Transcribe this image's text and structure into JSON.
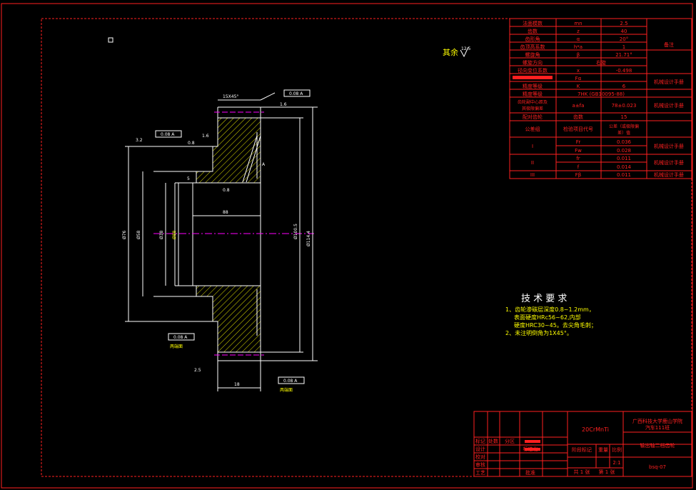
{
  "colors": {
    "background": "#000000",
    "frame": "#ff2020",
    "outline": "#ffffff",
    "dimension": "#ffff00",
    "centerline": "#ff00ff",
    "hatch": "#ffff00"
  },
  "surface_note": {
    "text": "其余",
    "roughness": "12.5"
  },
  "gear_drawing": {
    "chamfer_label": "15X45°",
    "tolerance_boxes": [
      "0.08 A",
      "0.08 A",
      "0.08 A",
      "0.08 A"
    ],
    "datum": "A",
    "dims": {
      "d_left_outer": "Ø76",
      "d_left_mid": "Ø58",
      "d_bore": "Ø38",
      "d_inner": "Ø88",
      "d_pitch": "Ø100.5",
      "d_tip": "Ø114.4",
      "width": "18",
      "bore_len": "88",
      "step_a": "1.6",
      "step_b": "0.8",
      "small_a": "2.5",
      "small_b": "5",
      "rough_a": "3.2",
      "rough_b": "1.6",
      "rough_c": "0.8"
    },
    "notes": [
      "两端面",
      "两端面"
    ]
  },
  "param_table": {
    "rows": [
      {
        "name": "法面模数",
        "symbol": "mn",
        "value": "2.5",
        "note": ""
      },
      {
        "name": "齿数",
        "symbol": "z",
        "value": "40",
        "note": ""
      },
      {
        "name": "齿形角",
        "symbol": "α",
        "value": "20°",
        "note": ""
      },
      {
        "name": "齿顶高系数",
        "symbol": "h*a",
        "value": "1",
        "note": ""
      },
      {
        "name": "螺旋角",
        "symbol": "β",
        "value": "21.71°",
        "note": ""
      },
      {
        "name": "螺旋方向",
        "symbol": "",
        "value": "右旋",
        "note": ""
      },
      {
        "name": "径向变位系数",
        "symbol": "x",
        "value": "-0.498",
        "note": ""
      },
      {
        "name": "",
        "symbol": "Fα",
        "value": "",
        "note": "机械设计手册"
      },
      {
        "name": "精度等级",
        "symbol": "K",
        "value": "6",
        "note": ""
      },
      {
        "name": "精度等级",
        "symbol": "",
        "value": "7HK (GB10095-88)",
        "note": ""
      },
      {
        "name": "齿轮副中心距及其极限偏差",
        "symbol": "a±fa",
        "value": "78±0.023",
        "note": "机械设计手册"
      },
      {
        "name": "配对齿轮",
        "symbol": "齿数",
        "value": "15",
        "note": ""
      }
    ],
    "group_header": {
      "a": "公差组",
      "b": "检验项目代号",
      "c": "公差（或极限偏差）值",
      "d": ""
    },
    "groups": [
      {
        "group": "I",
        "code1": "Fr",
        "val1": "0.036",
        "code2": "Fw",
        "val2": "0.028",
        "note": "机械设计手册"
      },
      {
        "group": "II",
        "code1": "fr",
        "val1": "0.011",
        "code2": "f",
        "val2": "0.014",
        "note": "机械设计手册"
      },
      {
        "group": "III",
        "code1": "Fβ",
        "val1": "0.011",
        "code2": "",
        "val2": "",
        "note": "机械设计手册"
      }
    ],
    "side_note": "备注"
  },
  "tech_req": {
    "title": "技 术 要 求",
    "lines": [
      "1、齿轮渗碳层深度0.8~1.2mm，",
      "表面硬度HRc56~62,内部",
      "硬度HRC30~45。去尖角毛刺；",
      "2、未注明倒角为1X45°。"
    ]
  },
  "title_block": {
    "material": "20CrMnTi",
    "school": "广西科技大学鹿山学院",
    "class": "汽车111班",
    "part_name": "输出轴二档齿轮",
    "drawing_no": "bsq-07",
    "scale": "2:1",
    "labels": {
      "mark": "标记",
      "count": "处数",
      "zone": "分区",
      "design": "设计",
      "check": "校对",
      "review": "审核",
      "process": "工艺",
      "std": "标准化",
      "approve": "批准",
      "stage": "阶段标记",
      "weight": "重量",
      "ratio": "比例",
      "sheet": "共 1 张",
      "page": "第 1 张"
    }
  }
}
